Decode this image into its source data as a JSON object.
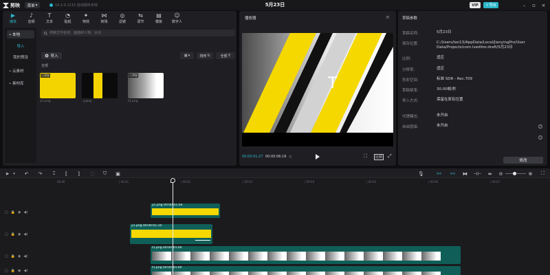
{
  "titlebar": {
    "app_name": "剪映",
    "menu_label": "菜单",
    "version_text": "14.2.0.1115 自动保存本地",
    "project_date": "5月23日",
    "vip_label": "VIP",
    "upload_label": "导出"
  },
  "toolbar": {
    "tools": [
      {
        "label": "媒体",
        "icon": "media-icon",
        "active": true
      },
      {
        "label": "音频",
        "icon": "audio-icon"
      },
      {
        "label": "文本",
        "icon": "text-icon"
      },
      {
        "label": "贴纸",
        "icon": "sticker-icon"
      },
      {
        "label": "特效",
        "icon": "effects-icon"
      },
      {
        "label": "转场",
        "icon": "transition-icon"
      },
      {
        "label": "滤镜",
        "icon": "filter-icon"
      },
      {
        "label": "调节",
        "icon": "adjust-icon"
      },
      {
        "label": "模板",
        "icon": "template-icon"
      },
      {
        "label": "数字人",
        "icon": "avatar-icon"
      }
    ]
  },
  "sidebar": {
    "items": [
      {
        "label": "• 本地",
        "active": true
      },
      {
        "label": "导入",
        "teal": true
      },
      {
        "label": "我的预设"
      },
      {
        "label": "• 云素材"
      },
      {
        "label": "• 素材库"
      }
    ]
  },
  "media": {
    "search_placeholder": "搜索文件名称、画面和人物、台词",
    "import_label": "导入",
    "sort_label": "排序",
    "filter_label": "全部",
    "all_header": "全部",
    "items": [
      {
        "name": "y1.png",
        "tag": "已添加"
      },
      {
        "name": "y.png",
        "tag": ""
      },
      {
        "name": "t1.png",
        "tag": "已添加"
      }
    ]
  },
  "player": {
    "title": "播放器",
    "current_time": "00:00:01:27",
    "duration": "00:00:06:16"
  },
  "params": {
    "title": "草稿参数",
    "rows": [
      {
        "key": "草稿名称:",
        "value": "5月23日"
      },
      {
        "key": "保存位置:",
        "value": "C:/Users/lan13/AppData/Local/JianyingPro/User Data/Projects/com.lveditor.draft/5月23日"
      },
      {
        "key": "比例:",
        "value": "适应"
      },
      {
        "key": "分辨率:",
        "value": "适应"
      },
      {
        "key": "色彩空间:",
        "value": "标准 SDR - Rec.709"
      },
      {
        "key": "草稿帧率:",
        "value": "30.00帧/秒"
      },
      {
        "key": "导入方式:",
        "value": "保留在原有位置"
      },
      {
        "key": "代理模式:",
        "value": "未开启"
      },
      {
        "key": "自由层级:",
        "value": "未开启"
      }
    ],
    "edit_label": "修改"
  },
  "timeline": {
    "ruler": [
      "00:00",
      "| 00:01",
      "| 00:02",
      "| 00:03",
      "| 00:04",
      "| 00:05",
      "| 00:06",
      "| 00:07"
    ],
    "clips": [
      {
        "label": "y1.png  00:00:01:04"
      },
      {
        "label": "y1.png  00:00:01:10"
      },
      {
        "label": "t1.png  00:00:05:00"
      },
      {
        "label": "t1.png  00:00:05:00"
      }
    ],
    "track_icons": [
      "lock-icon",
      "eye-icon",
      "speaker-icon"
    ]
  },
  "colors": {
    "accent": "#2bb7c9",
    "clip_green": "#0f5f58",
    "yellow": "#f5d800",
    "panel": "#1f1f23"
  }
}
